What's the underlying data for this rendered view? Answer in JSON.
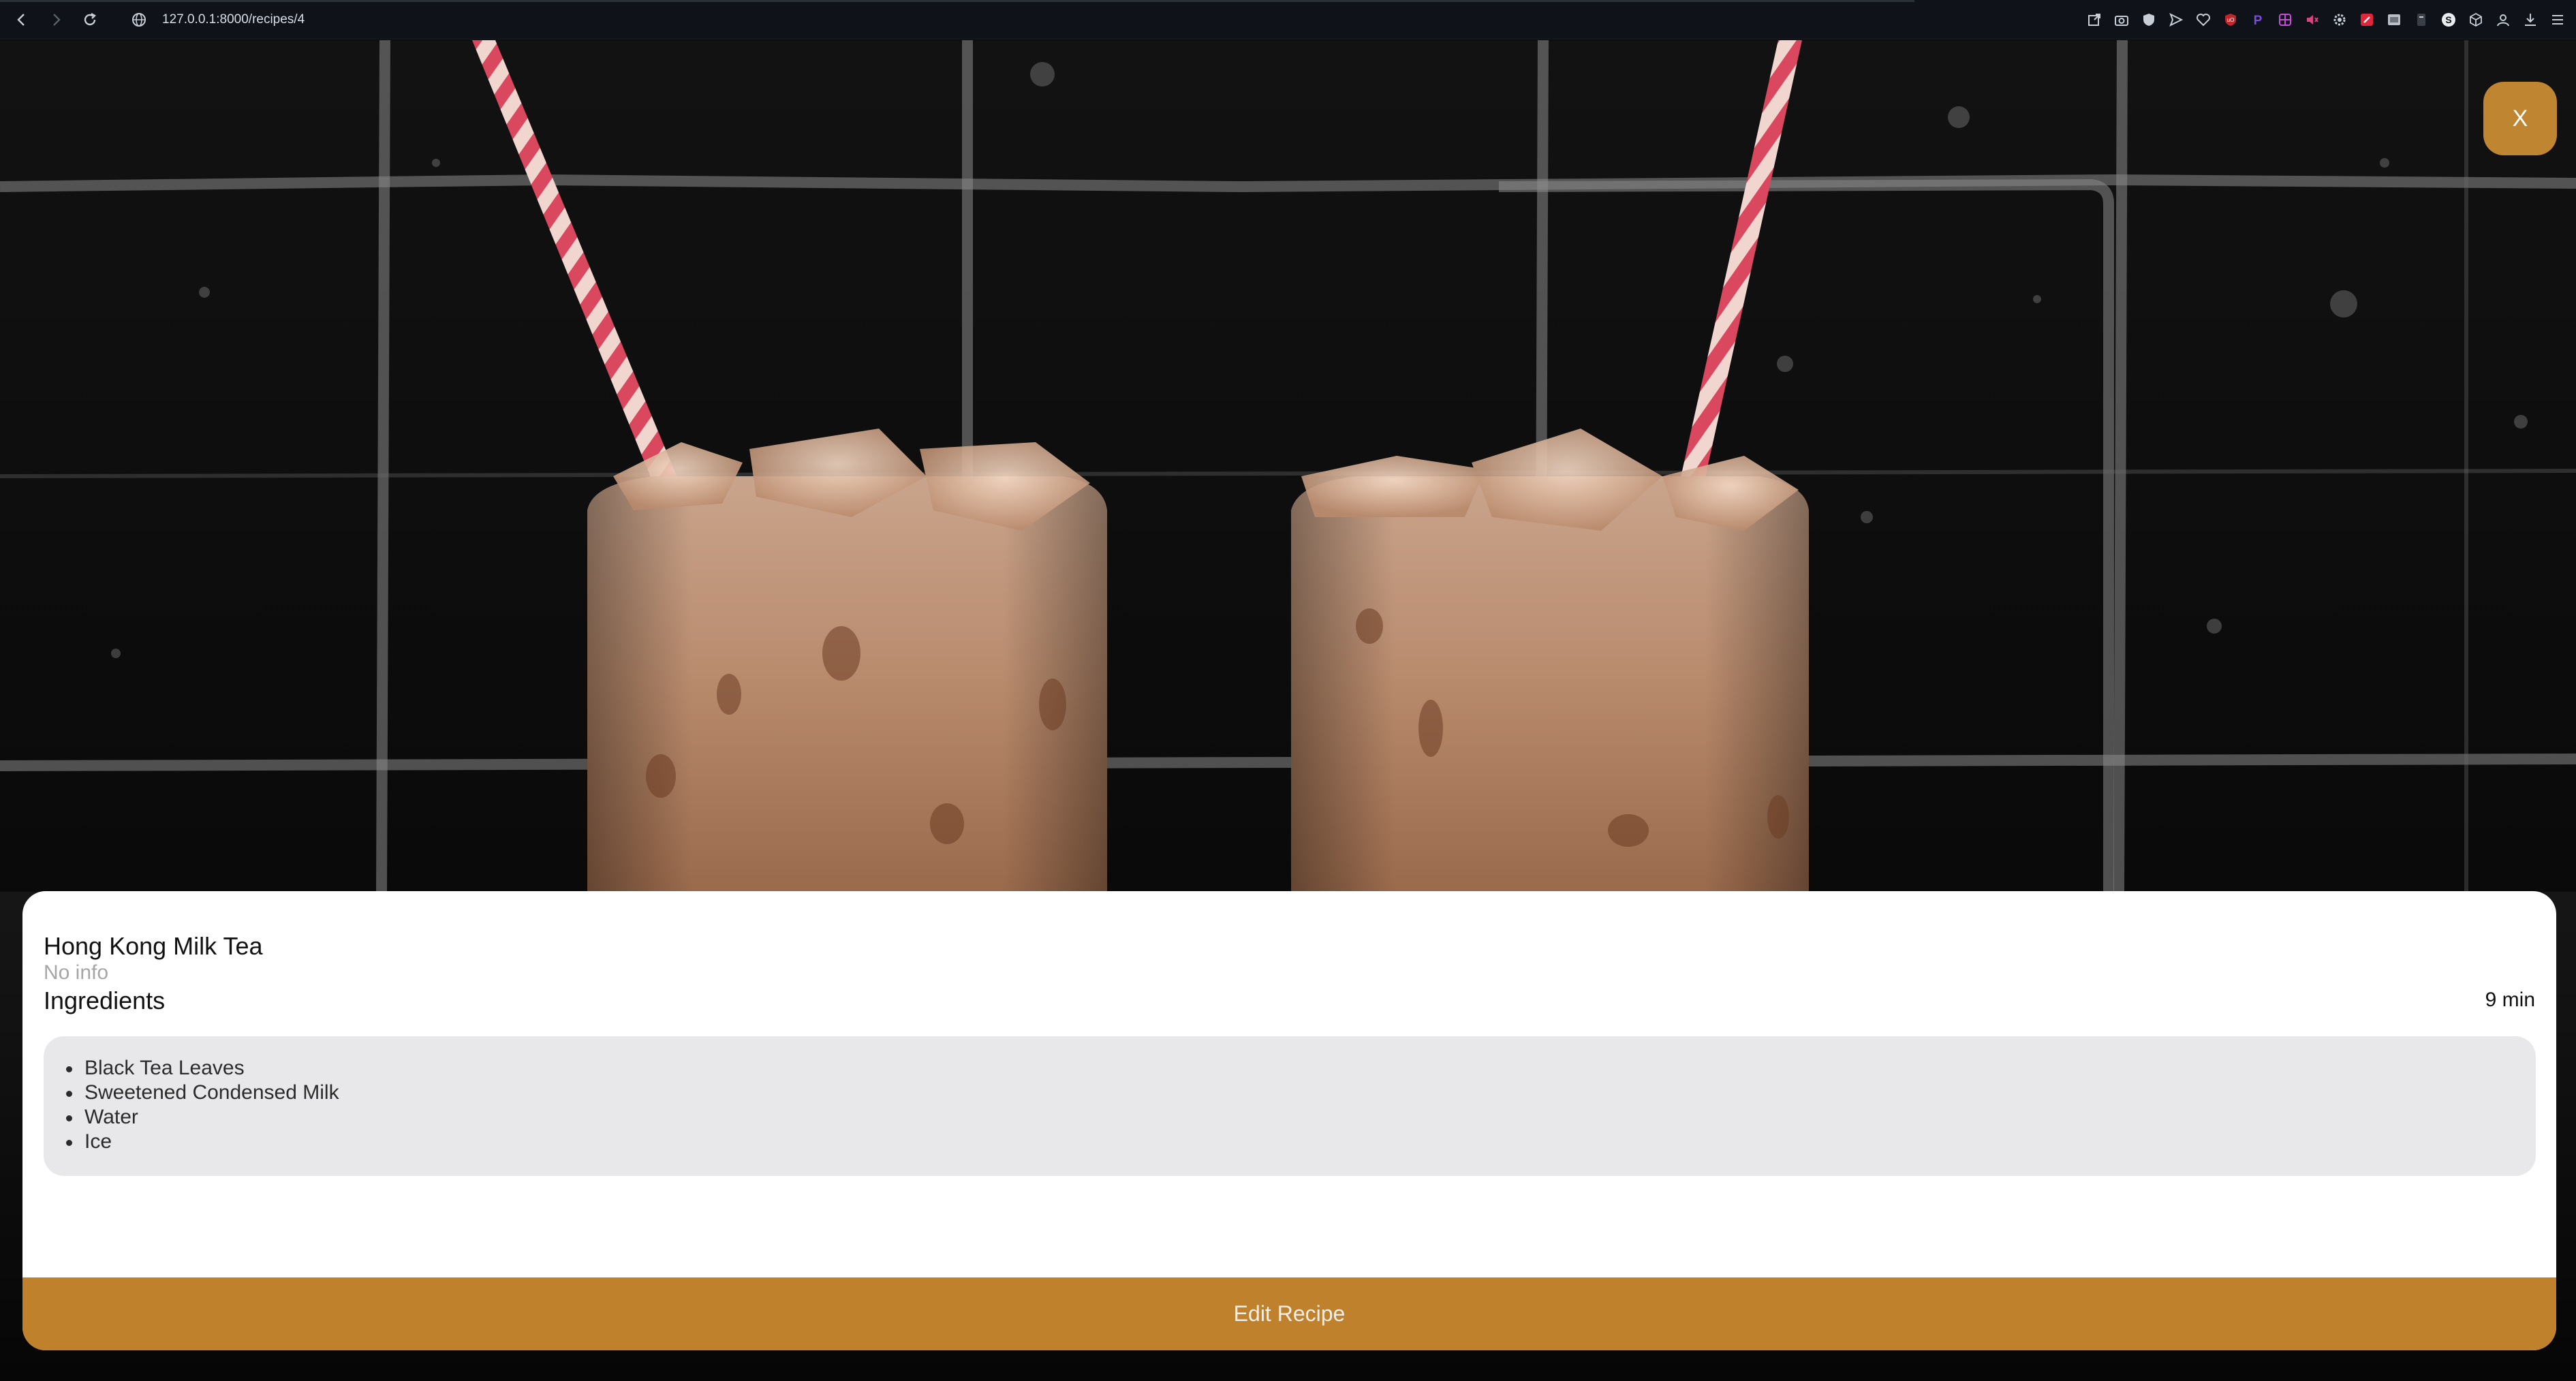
{
  "browser": {
    "url": "127.0.0.1:8000/recipes/4",
    "nav": {
      "back": "back-arrow-icon",
      "forward": "forward-arrow-icon",
      "reload": "reload-icon"
    },
    "extensions": [
      "share-icon",
      "camera-icon",
      "shield-icon",
      "send-icon",
      "heart-icon",
      "ublock-icon",
      "p-extension-icon",
      "grid-extension-icon",
      "speaker-icon",
      "settings-gear-icon",
      "red-extension-icon",
      "gray-extension-icon",
      "doc-extension-icon",
      "s-extension-icon",
      "cube-icon",
      "profile-icon",
      "download-icon",
      "menu-icon"
    ]
  },
  "close": {
    "label": "X",
    "color": "#bf8530"
  },
  "recipe": {
    "title": "Hong Kong Milk Tea",
    "info": "No info",
    "ingredients_heading": "Ingredients",
    "time": "9 min",
    "ingredients": [
      "Black Tea Leaves",
      "Sweetened Condensed Milk",
      "Water",
      "Ice"
    ]
  },
  "actions": {
    "edit_label": "Edit Recipe",
    "accent": "#bf812c"
  },
  "hero": {
    "image": "two-iced-milk-teas-with-straws-photo"
  }
}
